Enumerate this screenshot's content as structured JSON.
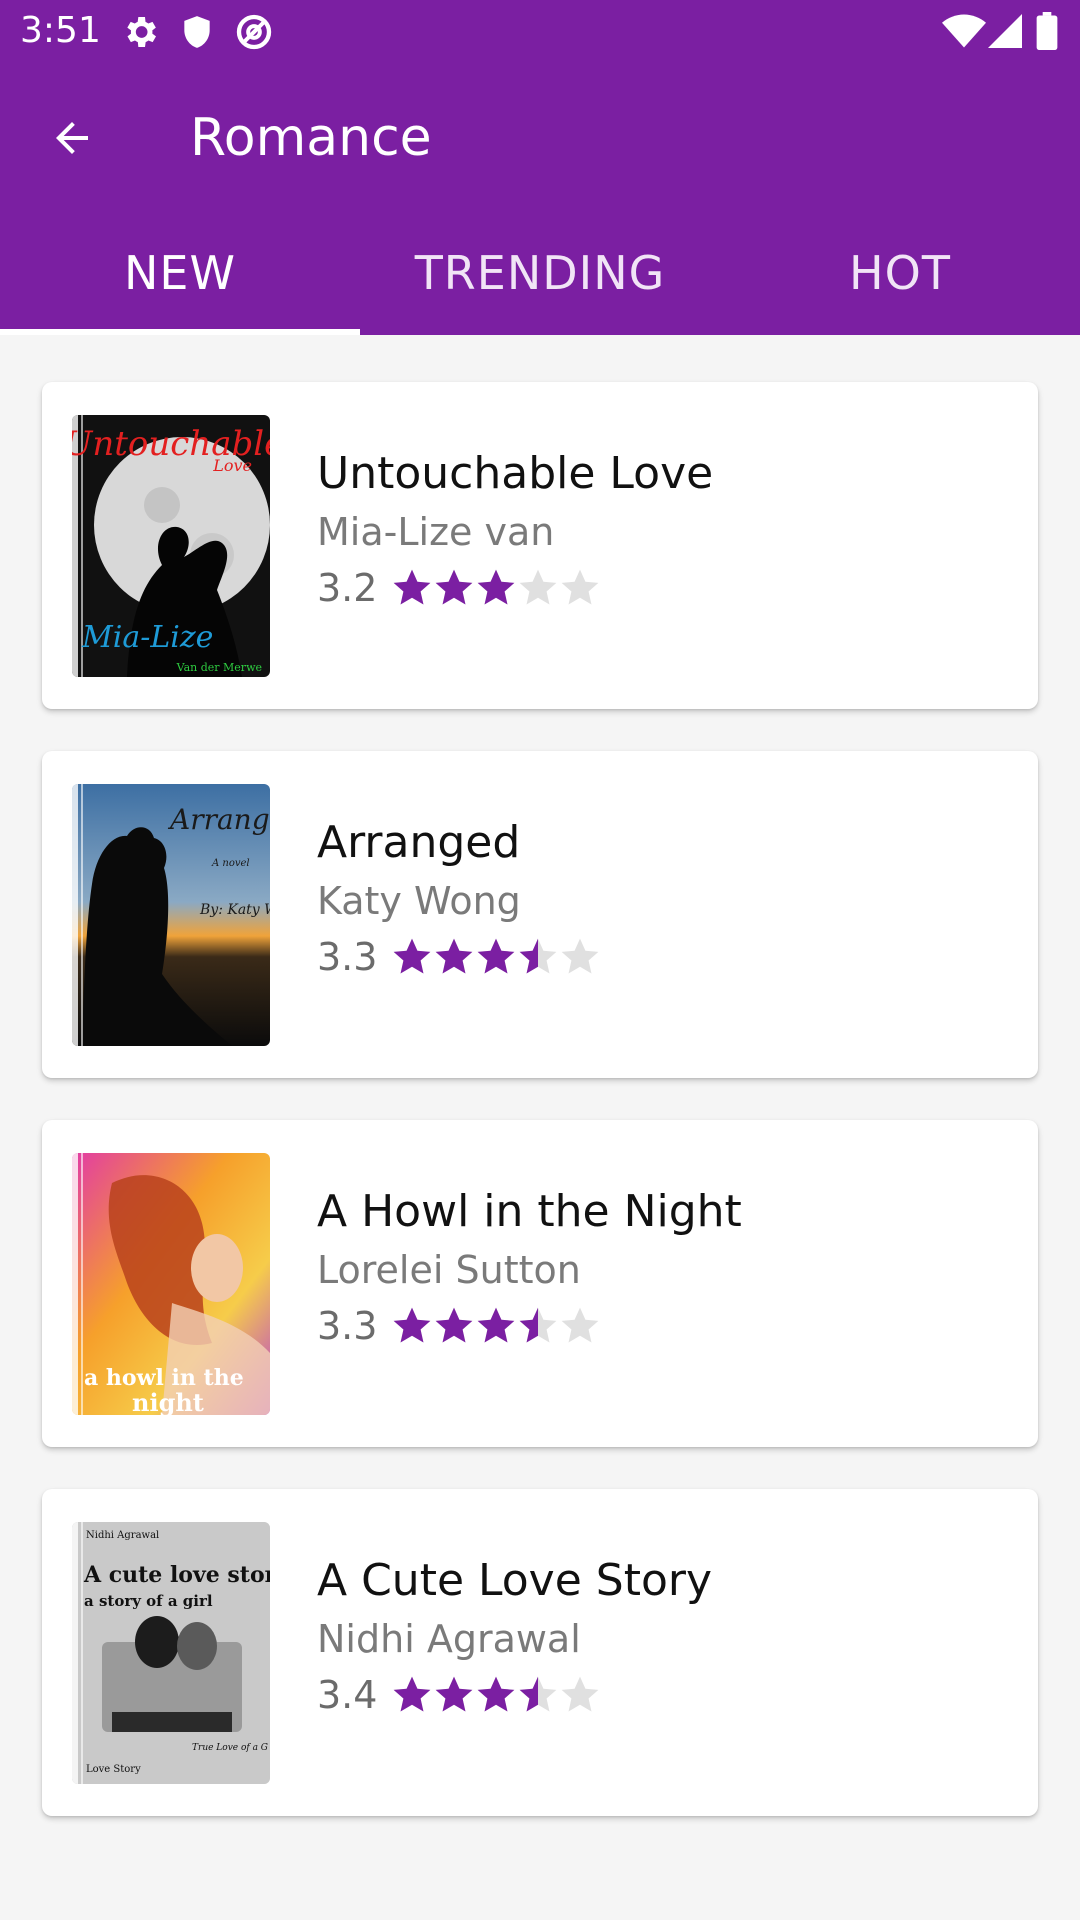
{
  "status_bar": {
    "time": "3:51",
    "left_icons": [
      "settings-icon",
      "shield-icon",
      "at-sign-icon"
    ],
    "right_icons": [
      "wifi-icon",
      "signal-icon",
      "battery-icon"
    ]
  },
  "toolbar": {
    "back_icon": "arrow-back-icon",
    "title": "Romance"
  },
  "tabs": [
    {
      "label": "NEW",
      "active": true
    },
    {
      "label": "TRENDING",
      "active": false
    },
    {
      "label": "HOT",
      "active": false
    }
  ],
  "books": [
    {
      "title": "Untouchable Love",
      "author": "Mia-Lize van",
      "rating": "3.2",
      "stars": 3.2,
      "cover_text": "Untouchable",
      "cover_subtext": "Love",
      "cover_author": "Mia-Lize",
      "cover_footer": "Van der Merwe"
    },
    {
      "title": "Arranged",
      "author": "Katy Wong",
      "rating": "3.3",
      "stars": 3.3,
      "cover_text": "Arranged",
      "cover_subtext": "A novel",
      "cover_author": "By: Katy Wong"
    },
    {
      "title": "A Howl in the Night",
      "author": "Lorelei Sutton",
      "rating": "3.3",
      "stars": 3.3,
      "cover_text": "a howl in the",
      "cover_subtext": "night"
    },
    {
      "title": "A Cute Love Story",
      "author": "Nidhi Agrawal",
      "rating": "3.4",
      "stars": 3.4,
      "cover_text": "A cute love story",
      "cover_subtext": "a story of a girl",
      "cover_author": "Nidhi Agrawal",
      "cover_footer": "Love Story",
      "cover_tagline": "True Love of a G"
    }
  ],
  "colors": {
    "primary": "#7b1fa2",
    "star_filled": "#7b1fa2",
    "star_empty": "#e0e0e0",
    "background": "#f5f5f5"
  }
}
